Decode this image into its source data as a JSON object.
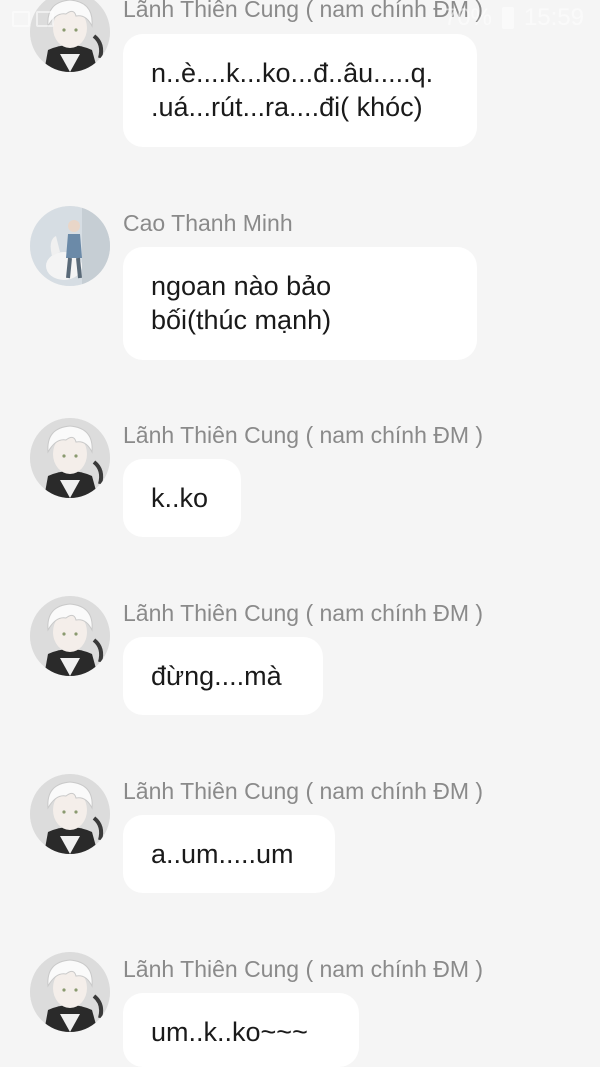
{
  "status_bar": {
    "battery": "70%",
    "time": "15:59"
  },
  "messages": [
    {
      "sender": "Lãnh Thiên Cung ( nam chính ĐM )",
      "avatar": "white-haired-boy-avatar",
      "text": "n..è....k...ko...đ..âu.....q.\n.uá...rút...ra....đi( khóc)"
    },
    {
      "sender": "Cao Thanh Minh",
      "avatar": "man-with-horse-avatar",
      "text": "ngoan nào bảo\nbối(thúc mạnh)"
    },
    {
      "sender": "Lãnh Thiên Cung ( nam chính ĐM )",
      "avatar": "white-haired-boy-avatar",
      "text": "k..ko"
    },
    {
      "sender": "Lãnh Thiên Cung ( nam chính ĐM )",
      "avatar": "white-haired-boy-avatar",
      "text": "đừng....mà"
    },
    {
      "sender": "Lãnh Thiên Cung ( nam chính ĐM )",
      "avatar": "white-haired-boy-avatar",
      "text": "a..um.....um"
    },
    {
      "sender": "Lãnh Thiên Cung ( nam chính ĐM )",
      "avatar": "white-haired-boy-avatar",
      "text": "um..k..ko~~~"
    }
  ]
}
